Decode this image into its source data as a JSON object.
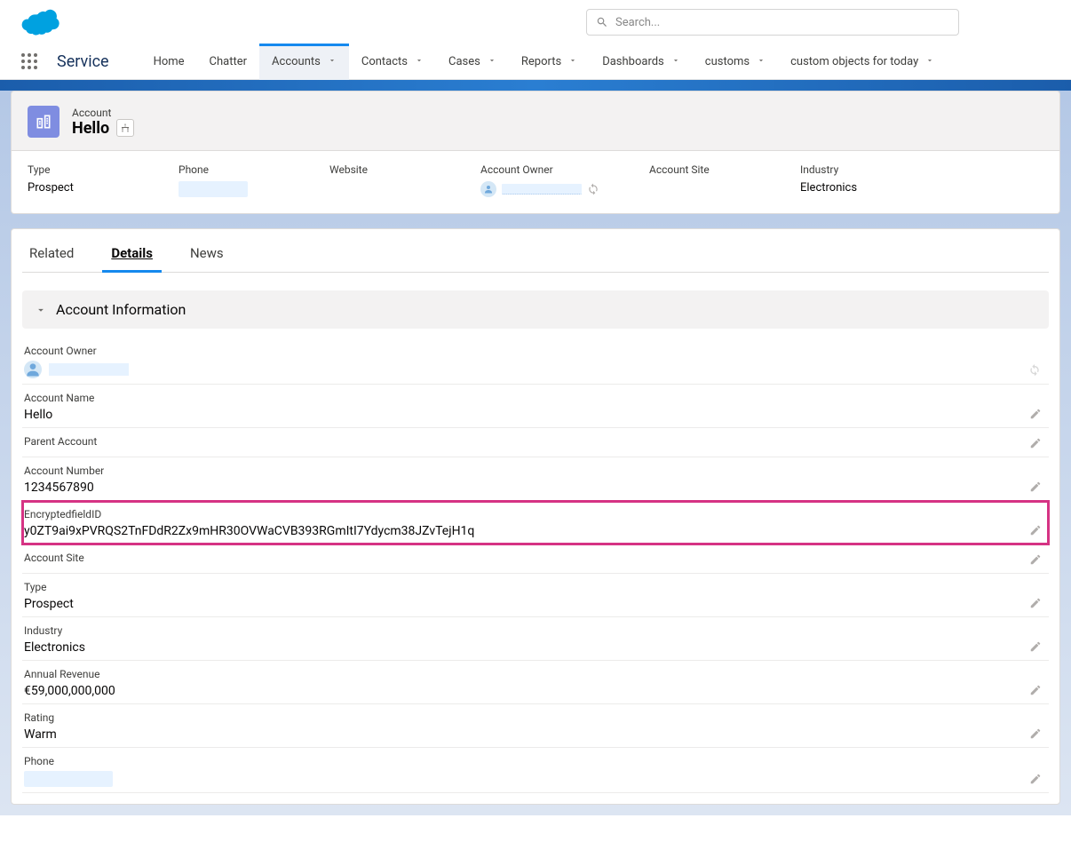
{
  "search": {
    "placeholder": "Search..."
  },
  "app_name": "Service",
  "nav": [
    {
      "label": "Home",
      "chevron": false,
      "active": false
    },
    {
      "label": "Chatter",
      "chevron": false,
      "active": false
    },
    {
      "label": "Accounts",
      "chevron": true,
      "active": true
    },
    {
      "label": "Contacts",
      "chevron": true,
      "active": false
    },
    {
      "label": "Cases",
      "chevron": true,
      "active": false
    },
    {
      "label": "Reports",
      "chevron": true,
      "active": false
    },
    {
      "label": "Dashboards",
      "chevron": true,
      "active": false
    },
    {
      "label": "customs",
      "chevron": true,
      "active": false
    },
    {
      "label": "custom objects for today",
      "chevron": true,
      "active": false
    }
  ],
  "record": {
    "object_label": "Account",
    "name": "Hello"
  },
  "highlights": {
    "type": {
      "label": "Type",
      "value": "Prospect"
    },
    "phone": {
      "label": "Phone"
    },
    "website": {
      "label": "Website",
      "value": ""
    },
    "owner": {
      "label": "Account Owner"
    },
    "site": {
      "label": "Account Site",
      "value": ""
    },
    "industry": {
      "label": "Industry",
      "value": "Electronics"
    }
  },
  "tabs": [
    {
      "label": "Related",
      "active": false
    },
    {
      "label": "Details",
      "active": true
    },
    {
      "label": "News",
      "active": false
    }
  ],
  "section_title": "Account Information",
  "fields": [
    {
      "key": "account_owner",
      "label": "Account Owner",
      "value": "",
      "redacted": true,
      "editable": false,
      "change_owner": true
    },
    {
      "key": "account_name",
      "label": "Account Name",
      "value": "Hello",
      "editable": true
    },
    {
      "key": "parent_account",
      "label": "Parent Account",
      "value": "",
      "editable": true
    },
    {
      "key": "account_number",
      "label": "Account Number",
      "value": "1234567890",
      "editable": true
    },
    {
      "key": "encrypted_field_id",
      "label": "EncryptedfieldID",
      "value": "y0ZT9ai9xPVRQS2TnFDdR2Zx9mHR30OVWaCVB393RGmItI7Ydycm38JZvTejH1q",
      "editable": true,
      "highlighted": true
    },
    {
      "key": "account_site",
      "label": "Account Site",
      "value": "",
      "editable": true
    },
    {
      "key": "type_field",
      "label": "Type",
      "value": "Prospect",
      "editable": true
    },
    {
      "key": "industry_field",
      "label": "Industry",
      "value": "Electronics",
      "editable": true
    },
    {
      "key": "annual_revenue",
      "label": "Annual Revenue",
      "value": "€59,000,000,000",
      "editable": true
    },
    {
      "key": "rating",
      "label": "Rating",
      "value": "Warm",
      "editable": true
    },
    {
      "key": "phone_field",
      "label": "Phone",
      "value": "",
      "redacted_small": true,
      "editable": true
    }
  ]
}
